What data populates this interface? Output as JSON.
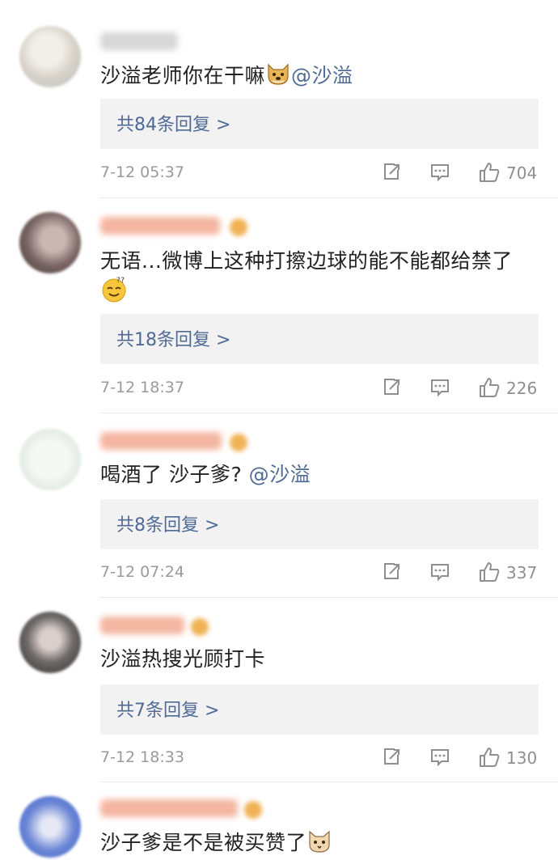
{
  "comments": [
    {
      "text_parts": [
        "沙溢老师你在干嘛",
        "@沙溢"
      ],
      "reply_label": "共84条回复 >",
      "time": "7-12 05:37",
      "likes": "704"
    },
    {
      "text_parts": [
        "无语...微博上这种打擦边球的能不能都给禁了"
      ],
      "reply_label": "共18条回复 >",
      "time": "7-12 18:37",
      "likes": "226"
    },
    {
      "text_parts": [
        "喝酒了 沙子爹?",
        "@沙溢"
      ],
      "reply_label": "共8条回复 >",
      "time": "7-12 07:24",
      "likes": "337"
    },
    {
      "text_parts": [
        "沙溢热搜光顾打卡"
      ],
      "reply_label": "共7条回复 >",
      "time": "7-12 18:33",
      "likes": "130"
    },
    {
      "text_parts": [
        "沙子爹是不是被买赞了"
      ]
    }
  ],
  "icons": {
    "share": "share-icon",
    "comment": "comment-icon",
    "like": "thumbs-up-icon",
    "doge_emoji": "doge-emoji-icon",
    "dizzy_emoji": "dizzy-face-emoji-icon",
    "cat_emoji": "cat-emoji-icon"
  },
  "colors": {
    "link": "#506a96",
    "reply_bg": "#f2f2f2",
    "meta_text": "#9a9a9a"
  }
}
